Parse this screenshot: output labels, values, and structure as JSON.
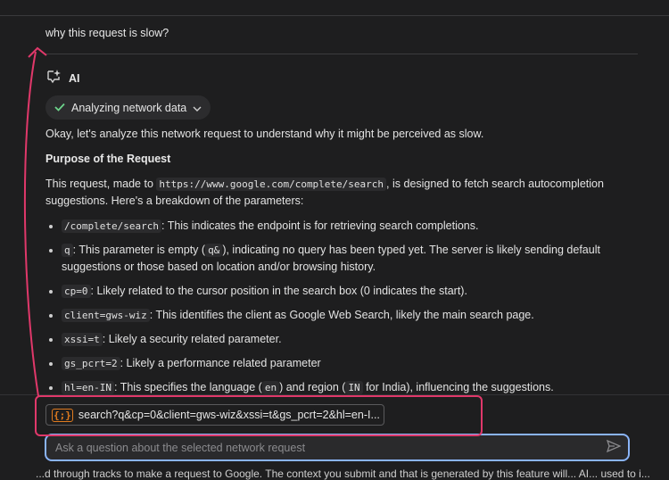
{
  "conversation": {
    "user_query": "why this request is slow?",
    "ai_label": "AI",
    "status_chip": "Analyzing network data"
  },
  "response": {
    "intro": "Okay, let's analyze this network request to understand why it might be perceived as slow.",
    "heading": "Purpose of the Request",
    "purpose_pre": "This request, made to ",
    "purpose_url": "https://www.google.com/complete/search",
    "purpose_post": ", is designed to fetch search autocompletion suggestions. Here's a breakdown of the parameters:",
    "params": [
      {
        "code": "/complete/search",
        "pre": "",
        "mid_code": "",
        "text": ": This indicates the endpoint is for retrieving search completions."
      },
      {
        "code": "q",
        "text1": ": This parameter is empty (",
        "code2": "q&",
        "text2": "), indicating no query has been typed yet. The server is likely sending default suggestions or those based on location and/or browsing history."
      },
      {
        "code": "cp=0",
        "text": ": Likely related to the cursor position in the search box (0 indicates the start)."
      },
      {
        "code": "client=gws-wiz",
        "text": ": This identifies the client as Google Web Search, likely the main search page."
      },
      {
        "code": "xssi=t",
        "text": ": Likely a security related parameter."
      },
      {
        "code": "gs_pcrt=2",
        "text": ": Likely a performance related parameter"
      },
      {
        "code": "hl=en-IN",
        "text1": ": This specifies the language (",
        "code2": "en",
        "text2": ") and region (",
        "code3": "IN",
        "text3": " for India), influencing the suggestions."
      }
    ]
  },
  "context_chip": {
    "icon": "{;}",
    "label": "search?q&cp=0&client=gws-wiz&xssi=t&gs_pcrt=2&hl=en-I..."
  },
  "input": {
    "placeholder": "Ask a question about the selected network request"
  },
  "bottom_text": "...d through tracks to make a request to Google. The context you submit and that is generated by this feature will... AI... used to i...",
  "colors": {
    "accent_blue": "#8ab4f8",
    "annotation_red": "#e0386a",
    "check_green": "#6dd58c",
    "json_icon_orange": "#e07b1f"
  }
}
